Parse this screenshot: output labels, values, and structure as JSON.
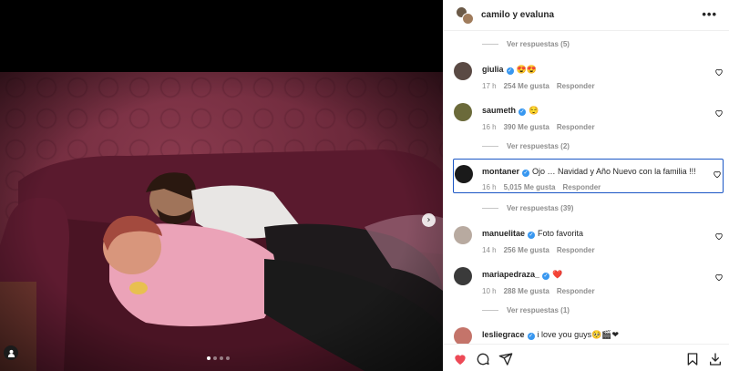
{
  "header": {
    "username": "camilo y evaluna"
  },
  "media": {
    "carousel_dots": 4,
    "active_dot": 0
  },
  "comments": {
    "view_replies": [
      "Ver respuestas (5)",
      "Ver respuestas (2)",
      "Ver respuestas (39)",
      "Ver respuestas (1)"
    ],
    "items": [
      {
        "user": "giulia",
        "text": "😍😍",
        "time": "17 h",
        "likes": "254 Me gusta",
        "reply": "Responder",
        "avatar_color": "#5a4a44"
      },
      {
        "user": "saumeth",
        "text": "😌",
        "time": "16 h",
        "likes": "390 Me gusta",
        "reply": "Responder",
        "avatar_color": "#6b6a3a"
      },
      {
        "user": "montaner",
        "text": "Ojo … Navidad y Año Nuevo con la familia !!!",
        "time": "16 h",
        "likes": "5,015 Me gusta",
        "reply": "Responder",
        "avatar_color": "#1a1a1a"
      },
      {
        "user": "manuelitae",
        "text": "Foto favorita",
        "time": "14 h",
        "likes": "256 Me gusta",
        "reply": "Responder",
        "avatar_color": "#b8aaa0"
      },
      {
        "user": "mariapedraza_",
        "text": "❤️",
        "time": "10 h",
        "likes": "288 Me gusta",
        "reply": "Responder",
        "avatar_color": "#3a3a3a"
      },
      {
        "user": "lesliegrace",
        "text": "i love you guys🥺🎬❤",
        "time": "",
        "likes": "",
        "reply": "",
        "avatar_color": "#c4746a"
      }
    ]
  },
  "colors": {
    "like_red": "#ed4956",
    "verified_blue": "#3897f0",
    "highlight_border": "#1a56c5"
  },
  "icons": {
    "like": "heart-filled-icon",
    "comment": "comment-bubble-icon",
    "share": "paper-plane-icon",
    "save": "bookmark-icon",
    "download": "download-icon",
    "more": "ellipsis-icon",
    "next": "chevron-right-icon",
    "tag": "user-tag-icon"
  }
}
